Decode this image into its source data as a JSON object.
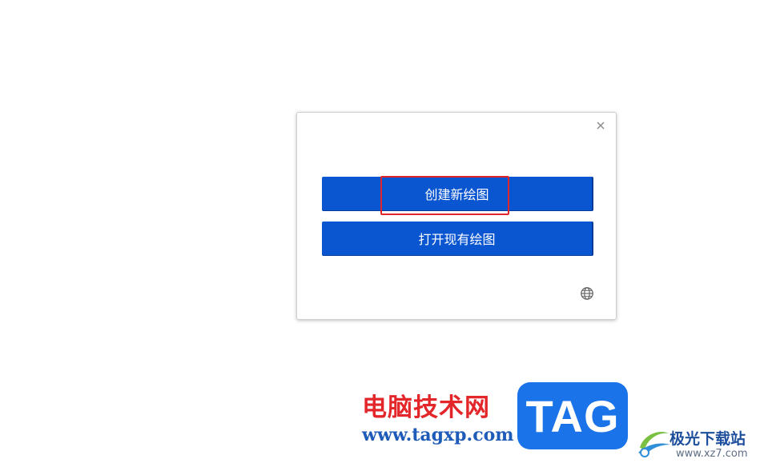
{
  "dialog": {
    "create_new_label": "创建新绘图",
    "open_existing_label": "打开现有绘图"
  },
  "watermark": {
    "site_name_cn": "电脑技术网",
    "site_url": "www.tagxp.com",
    "logo_text": "TAG",
    "download_site_name": "极光下载站",
    "download_site_url": "www.xz7.com"
  },
  "colors": {
    "button_blue": "#0a55d0",
    "highlight_red": "#e0262b",
    "watermark_red": "#e3262a",
    "watermark_blue": "#1f5bb8",
    "tag_logo_blue": "#1a73e8"
  },
  "icons": {
    "close": "close-icon",
    "language": "globe-icon"
  }
}
